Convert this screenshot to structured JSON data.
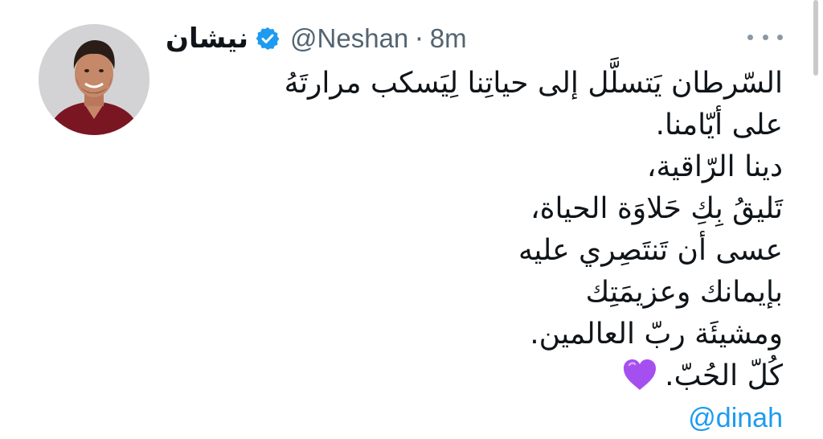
{
  "tweet": {
    "display_name": "نيشان",
    "handle": "@Neshan",
    "separator": "·",
    "time": "8m",
    "verified_icon": "verified-badge-icon",
    "more_icon": "more-options-icon",
    "lines": [
      "السّرطان يَتسلَّل إلى حياتِنا لِيَسكب مرارتَهُ",
      "على أيّامنا.",
      "دينا الرّاقية،",
      "تَليقُ بِكِ حَلاوَة الحياة،",
      "عسى أن تَنتَصِري عليه",
      "بإيمانك وعزيمَتِك",
      "ومشيئَة ربّ العالمين.",
      "كُلّ الحُبّ."
    ],
    "heart_emoji": "purple-heart-icon",
    "mention": "@dinah",
    "colors": {
      "text": "#0f1419",
      "secondary": "#536471",
      "link": "#1d9bf0",
      "verified": "#1d9bf0",
      "heart": "#a64ff0"
    }
  }
}
